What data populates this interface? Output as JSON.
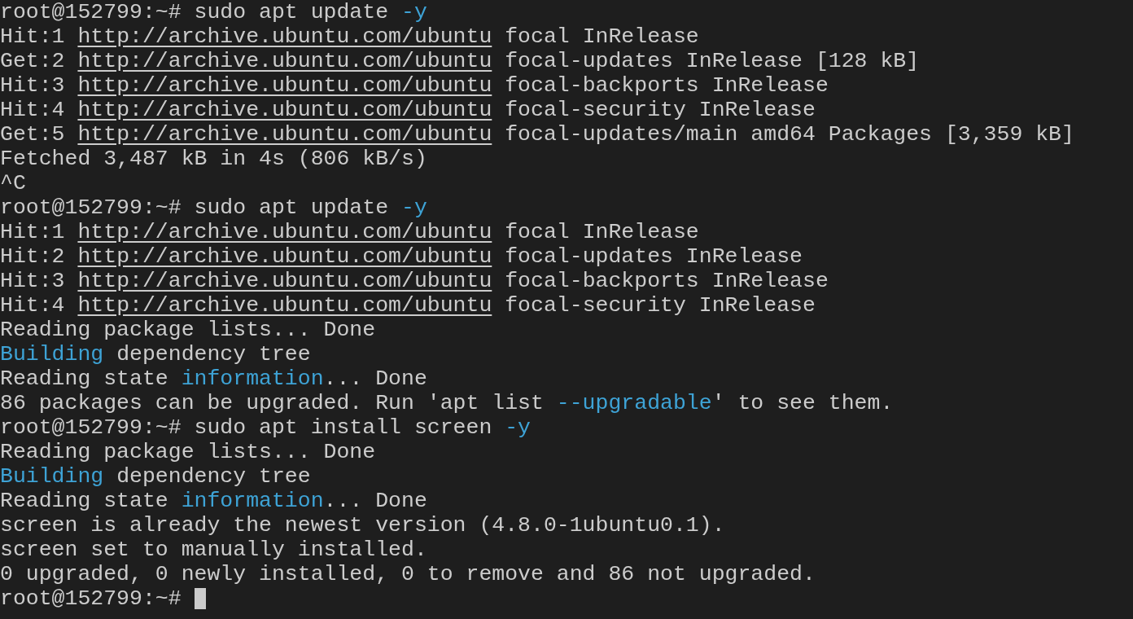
{
  "terminal": {
    "lines": [
      {
        "segments": [
          {
            "text": "root@152799:~# sudo apt update ",
            "kind": "plain"
          },
          {
            "text": "-y",
            "kind": "accent"
          }
        ]
      },
      {
        "segments": [
          {
            "text": "Hit:1 ",
            "kind": "plain"
          },
          {
            "text": "http://archive.ubuntu.com/ubuntu",
            "kind": "link"
          },
          {
            "text": " focal InRelease",
            "kind": "plain"
          }
        ]
      },
      {
        "segments": [
          {
            "text": "Get:2 ",
            "kind": "plain"
          },
          {
            "text": "http://archive.ubuntu.com/ubuntu",
            "kind": "link"
          },
          {
            "text": " focal-updates InRelease [128 kB]",
            "kind": "plain"
          }
        ]
      },
      {
        "segments": [
          {
            "text": "Hit:3 ",
            "kind": "plain"
          },
          {
            "text": "http://archive.ubuntu.com/ubuntu",
            "kind": "link"
          },
          {
            "text": " focal-backports InRelease",
            "kind": "plain"
          }
        ]
      },
      {
        "segments": [
          {
            "text": "Hit:4 ",
            "kind": "plain"
          },
          {
            "text": "http://archive.ubuntu.com/ubuntu",
            "kind": "link"
          },
          {
            "text": " focal-security InRelease",
            "kind": "plain"
          }
        ]
      },
      {
        "segments": [
          {
            "text": "Get:5 ",
            "kind": "plain"
          },
          {
            "text": "http://archive.ubuntu.com/ubuntu",
            "kind": "link"
          },
          {
            "text": " focal-updates/main amd64 Packages [3,359 kB]",
            "kind": "plain"
          }
        ]
      },
      {
        "segments": [
          {
            "text": "Fetched 3,487 kB in 4s (806 kB/s)",
            "kind": "plain"
          }
        ]
      },
      {
        "segments": [
          {
            "text": "^C",
            "kind": "plain"
          }
        ]
      },
      {
        "segments": [
          {
            "text": "root@152799:~# sudo apt update ",
            "kind": "plain"
          },
          {
            "text": "-y",
            "kind": "accent"
          }
        ]
      },
      {
        "segments": [
          {
            "text": "Hit:1 ",
            "kind": "plain"
          },
          {
            "text": "http://archive.ubuntu.com/ubuntu",
            "kind": "link"
          },
          {
            "text": " focal InRelease",
            "kind": "plain"
          }
        ]
      },
      {
        "segments": [
          {
            "text": "Hit:2 ",
            "kind": "plain"
          },
          {
            "text": "http://archive.ubuntu.com/ubuntu",
            "kind": "link"
          },
          {
            "text": " focal-updates InRelease",
            "kind": "plain"
          }
        ]
      },
      {
        "segments": [
          {
            "text": "Hit:3 ",
            "kind": "plain"
          },
          {
            "text": "http://archive.ubuntu.com/ubuntu",
            "kind": "link"
          },
          {
            "text": " focal-backports InRelease",
            "kind": "plain"
          }
        ]
      },
      {
        "segments": [
          {
            "text": "Hit:4 ",
            "kind": "plain"
          },
          {
            "text": "http://archive.ubuntu.com/ubuntu",
            "kind": "link"
          },
          {
            "text": " focal-security InRelease",
            "kind": "plain"
          }
        ]
      },
      {
        "segments": [
          {
            "text": "Reading package lists... Done",
            "kind": "plain"
          }
        ]
      },
      {
        "segments": [
          {
            "text": "Building",
            "kind": "accent"
          },
          {
            "text": " dependency tree",
            "kind": "plain"
          }
        ]
      },
      {
        "segments": [
          {
            "text": "Reading state ",
            "kind": "plain"
          },
          {
            "text": "information",
            "kind": "accent"
          },
          {
            "text": "... Done",
            "kind": "plain"
          }
        ]
      },
      {
        "segments": [
          {
            "text": "86 packages can be upgraded. Run 'apt list ",
            "kind": "plain"
          },
          {
            "text": "--upgradable",
            "kind": "accent"
          },
          {
            "text": "' to see them.",
            "kind": "plain"
          }
        ]
      },
      {
        "segments": [
          {
            "text": "root@152799:~# sudo apt install screen ",
            "kind": "plain"
          },
          {
            "text": "-y",
            "kind": "accent"
          }
        ]
      },
      {
        "segments": [
          {
            "text": "Reading package lists... Done",
            "kind": "plain"
          }
        ]
      },
      {
        "segments": [
          {
            "text": "Building",
            "kind": "accent"
          },
          {
            "text": " dependency tree",
            "kind": "plain"
          }
        ]
      },
      {
        "segments": [
          {
            "text": "Reading state ",
            "kind": "plain"
          },
          {
            "text": "information",
            "kind": "accent"
          },
          {
            "text": "... Done",
            "kind": "plain"
          }
        ]
      },
      {
        "segments": [
          {
            "text": "screen is already the newest version (4.8.0-1ubuntu0.1).",
            "kind": "plain"
          }
        ]
      },
      {
        "segments": [
          {
            "text": "screen set to manually installed.",
            "kind": "plain"
          }
        ]
      },
      {
        "segments": [
          {
            "text": "0 upgraded, 0 newly installed, 0 to remove and 86 not upgraded.",
            "kind": "plain"
          }
        ]
      },
      {
        "segments": [
          {
            "text": "root@152799:~# ",
            "kind": "plain"
          }
        ]
      }
    ]
  }
}
